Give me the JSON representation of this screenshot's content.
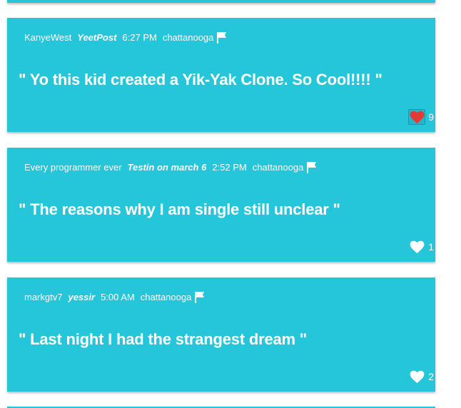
{
  "theme": {
    "card_bg": "#26c6da",
    "heart_liked_color": "#e53935",
    "heart_color": "#ffffff"
  },
  "posts": [
    {
      "author": "KanyeWest",
      "topic": "YeetPost",
      "time": "6:27 PM",
      "location": "chattanooga",
      "message": "\" Yo this kid created a Yik-Yak Clone. So Cool!!!! \"",
      "likes": "9",
      "liked": true,
      "flag_icon": "flag-icon",
      "heart_icon": "heart-icon"
    },
    {
      "author": "Every programmer ever",
      "topic": "Testin on march 6",
      "time": "2:52 PM",
      "location": "chattanooga",
      "message": "\" The reasons why I am single still unclear \"",
      "likes": "1",
      "liked": false,
      "flag_icon": "flag-icon",
      "heart_icon": "heart-icon"
    },
    {
      "author": "markgtv7",
      "topic": "yessir",
      "time": "5:00 AM",
      "location": "chattanooga",
      "message": "\" Last night I had the strangest dream \"",
      "likes": "2",
      "liked": false,
      "flag_icon": "flag-icon",
      "heart_icon": "heart-icon"
    }
  ]
}
